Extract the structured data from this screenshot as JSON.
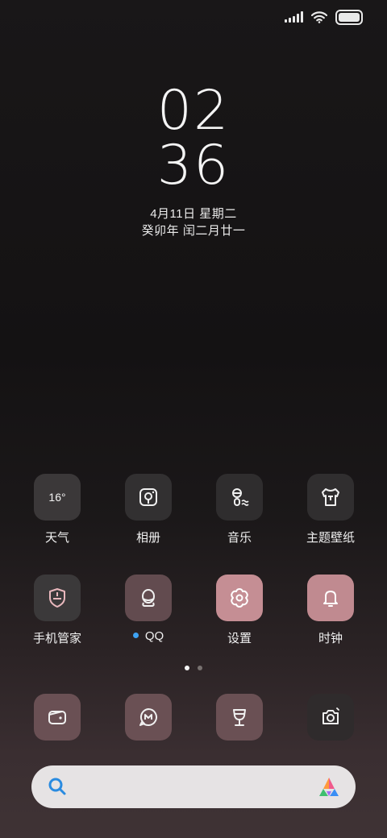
{
  "status_bar": {
    "signal_icon": "signal-bars-icon",
    "wifi_icon": "wifi-icon",
    "battery_icon": "battery-icon",
    "battery_level": 1.0
  },
  "clock": {
    "hours": "02",
    "minutes": "36",
    "date": "4月11日 星期二",
    "lunar_date": "癸卯年 闰二月廿一"
  },
  "apps_row1": [
    {
      "label": "天气",
      "icon": "weather-icon",
      "temp": "16°",
      "bg": "#3b3839"
    },
    {
      "label": "相册",
      "icon": "gallery-icon",
      "bg": "#323031"
    },
    {
      "label": "音乐",
      "icon": "music-icon",
      "bg": "#2f2d2e"
    },
    {
      "label": "主题壁纸",
      "icon": "theme-shirt-icon",
      "bg": "#302e2f"
    }
  ],
  "apps_row2": [
    {
      "label": "手机管家",
      "icon": "security-shield-icon",
      "bg": "#3b393a"
    },
    {
      "label": "QQ",
      "icon": "qq-penguin-icon",
      "bg": "#624b4f",
      "has_notification": true
    },
    {
      "label": "设置",
      "icon": "settings-gear-icon",
      "bg": "#c58e94"
    },
    {
      "label": "时钟",
      "icon": "alarm-bell-icon",
      "bg": "#c08a90"
    }
  ],
  "dock": [
    {
      "icon": "wallet-icon",
      "bg": "#6a5054"
    },
    {
      "icon": "message-icon",
      "bg": "#6a5054"
    },
    {
      "icon": "wine-glass-icon",
      "bg": "#6a5054"
    },
    {
      "icon": "camera-icon",
      "bg": "#2f2b2c"
    }
  ],
  "page_indicator": {
    "total": 2,
    "current": 1
  },
  "search_bar": {
    "icon": "search-icon",
    "assistant_icon": "app-assistant-logo-icon"
  },
  "colors": {
    "accent_blue": "#2a8be0",
    "notification_dot": "#3ea2f2",
    "search_bg": "#e6e3e4"
  }
}
